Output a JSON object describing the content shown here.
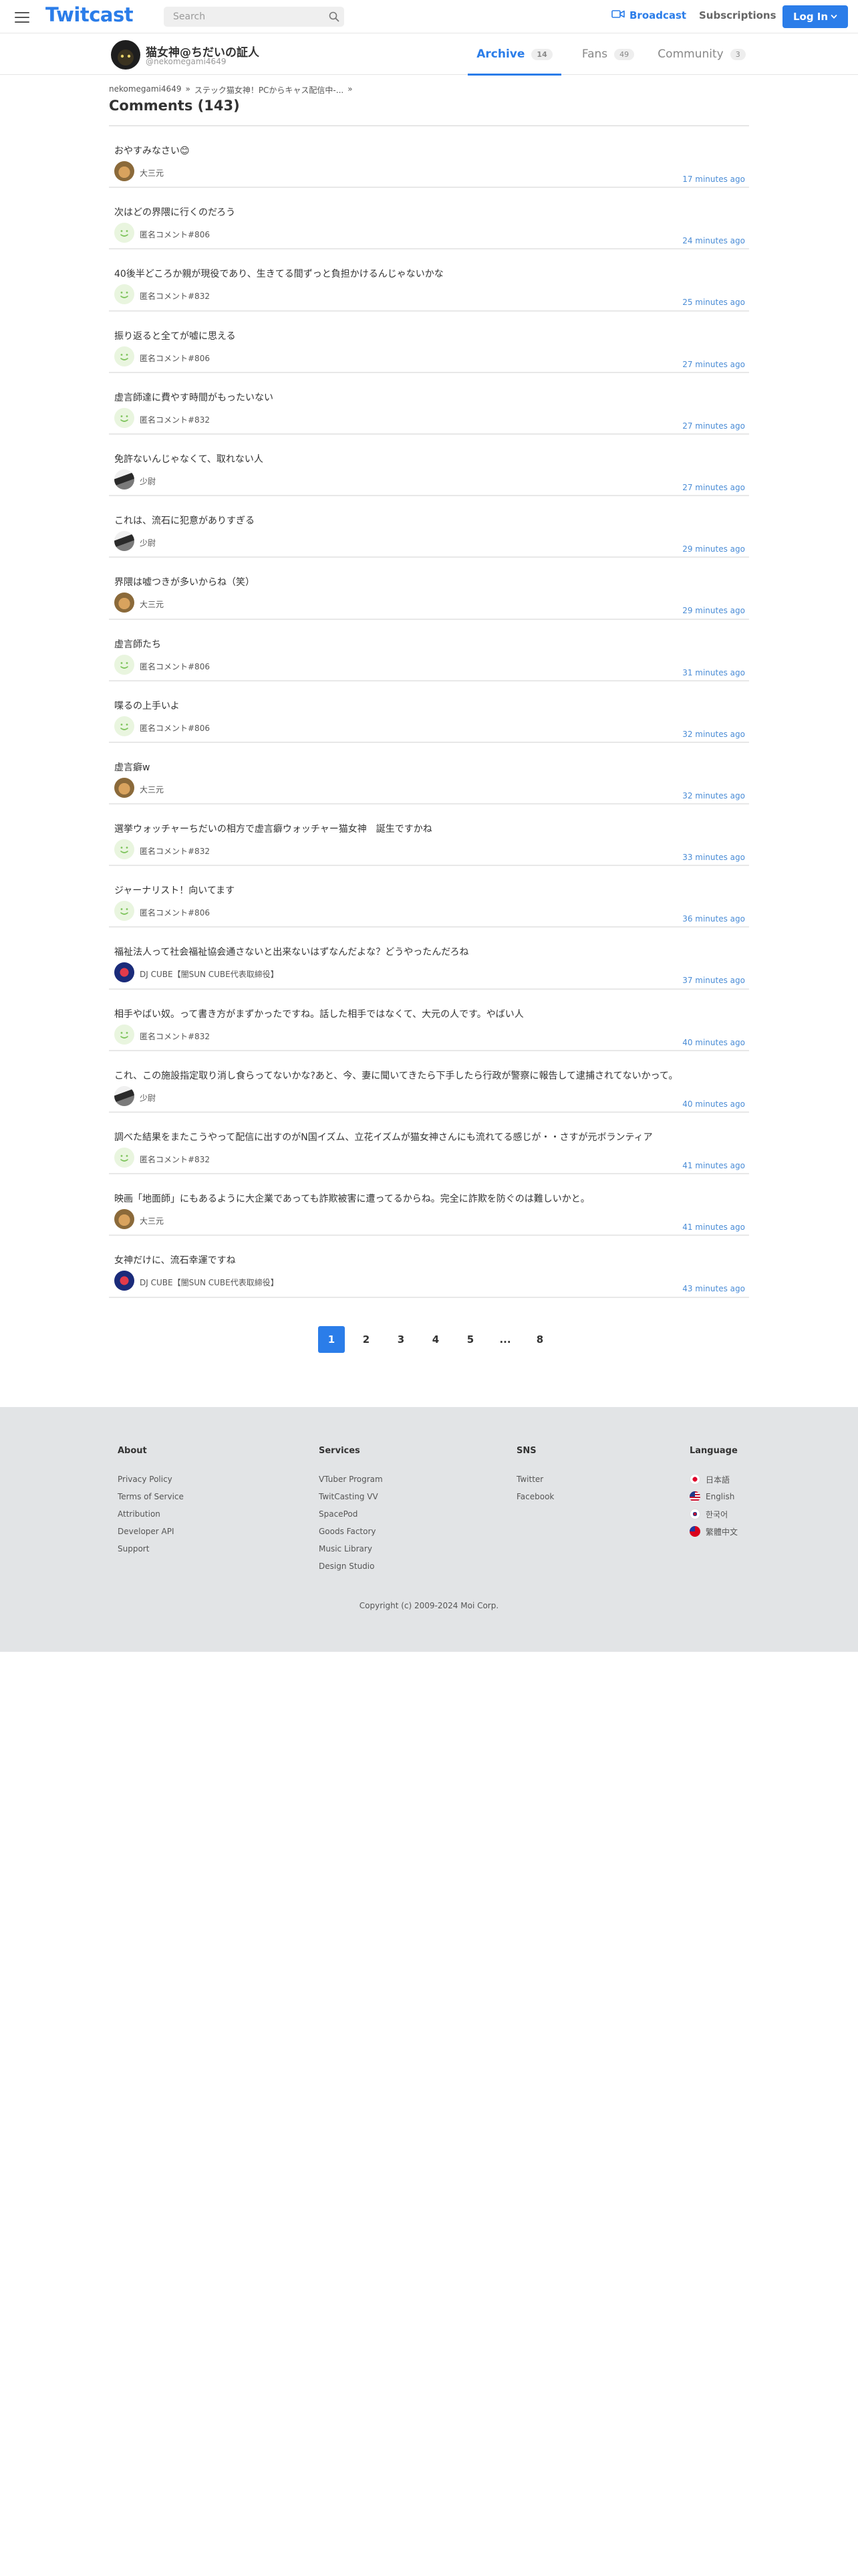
{
  "header": {
    "logo": "Twitcast",
    "search_placeholder": "Search",
    "broadcast": "Broadcast",
    "subscriptions": "Subscriptions",
    "login": "Log In"
  },
  "user": {
    "name": "猫女神@ちだいの証人",
    "id": "@nekomegami4649"
  },
  "tabs": [
    {
      "label": "Archive",
      "count": "14"
    },
    {
      "label": "Fans",
      "count": "49"
    },
    {
      "label": "Community",
      "count": "3"
    }
  ],
  "breadcrumb": {
    "user": "nekomegami4649",
    "sep1": "»",
    "movie": "ステック猫女神！PCからキャス配信中-...",
    "sep2": "»"
  },
  "comments_title": "Comments (143)",
  "comments": [
    {
      "text": "おやすみなさい😊",
      "user": "大三元",
      "time": "17 minutes ago",
      "avatar": "cat"
    },
    {
      "text": "次はどの界隈に行くのだろう",
      "user": "匿名コメント#806",
      "time": "24 minutes ago",
      "avatar": "smile"
    },
    {
      "text": "40後半どころか親が現役であり、生きてる間ずっと負担かけるんじゃないかな",
      "user": "匿名コメント#832",
      "time": "25 minutes ago",
      "avatar": "smile"
    },
    {
      "text": "振り返ると全てが嘘に思える",
      "user": "匿名コメント#806",
      "time": "27 minutes ago",
      "avatar": "smile"
    },
    {
      "text": "虚言師達に費やす時間がもったいない",
      "user": "匿名コメント#832",
      "time": "27 minutes ago",
      "avatar": "smile"
    },
    {
      "text": "免許ないんじゃなくて、取れない人",
      "user": "少尉",
      "time": "27 minutes ago",
      "avatar": "bw"
    },
    {
      "text": "これは、流石に犯意がありすぎる",
      "user": "少尉",
      "time": "29 minutes ago",
      "avatar": "bw"
    },
    {
      "text": "界隈は嘘つきが多いからね（笑）",
      "user": "大三元",
      "time": "29 minutes ago",
      "avatar": "cat"
    },
    {
      "text": "虚言師たち",
      "user": "匿名コメント#806",
      "time": "31 minutes ago",
      "avatar": "smile"
    },
    {
      "text": "喋るの上手いよ",
      "user": "匿名コメント#806",
      "time": "32 minutes ago",
      "avatar": "smile"
    },
    {
      "text": "虚言癖w",
      "user": "大三元",
      "time": "32 minutes ago",
      "avatar": "cat"
    },
    {
      "text": "選挙ウォッチャーちだいの相方で虚言癖ウォッチャー猫女神　誕生ですかね",
      "user": "匿名コメント#832",
      "time": "33 minutes ago",
      "avatar": "smile"
    },
    {
      "text": "ジャーナリスト！向いてます",
      "user": "匿名コメント#806",
      "time": "36 minutes ago",
      "avatar": "smile"
    },
    {
      "text": "福祉法人って社会福祉協会通さないと出来ないはずなんだよな？どうやったんだろね",
      "user": "DJ CUBE【闇SUN CUBE代表取締役】",
      "time": "37 minutes ago",
      "avatar": "dj"
    },
    {
      "text": "相手やばい奴。って書き方がまずかったですね。話した相手ではなくて、大元の人です。やばい人",
      "user": "匿名コメント#832",
      "time": "40 minutes ago",
      "avatar": "smile"
    },
    {
      "text": "これ、この施設指定取り消し食らってないかな?あと、今、妻に聞いてきたら下手したら行政が警察に報告して逮捕されてないかって。",
      "user": "少尉",
      "time": "40 minutes ago",
      "avatar": "bw"
    },
    {
      "text": "調べた結果をまたこうやって配信に出すのがN国イズム、立花イズムが猫女神さんにも流れてる感じが・・さすが元ボランティア",
      "user": "匿名コメント#832",
      "time": "41 minutes ago",
      "avatar": "smile"
    },
    {
      "text": "映画「地面師」にもあるように大企業であっても詐欺被害に遭ってるからね。完全に詐欺を防ぐのは難しいかと。",
      "user": "大三元",
      "time": "41 minutes ago",
      "avatar": "cat"
    },
    {
      "text": "女神だけに、流石幸運ですね",
      "user": "DJ CUBE【闇SUN CUBE代表取締役】",
      "time": "43 minutes ago",
      "avatar": "dj"
    }
  ],
  "pagination": [
    "1",
    "2",
    "3",
    "4",
    "5",
    "...",
    "8"
  ],
  "footer": {
    "about": {
      "title": "About",
      "items": [
        "Privacy Policy",
        "Terms of Service",
        "Attribution",
        "Developer API",
        "Support"
      ]
    },
    "services": {
      "title": "Services",
      "items": [
        "VTuber Program",
        "TwitCasting VV",
        "SpacePod",
        "Goods Factory",
        "Music Library",
        "Design Studio"
      ]
    },
    "sns": {
      "title": "SNS",
      "items": [
        "Twitter",
        "Facebook"
      ]
    },
    "language": {
      "title": "Language",
      "items": [
        {
          "label": "日本語",
          "flag": "jp"
        },
        {
          "label": "English",
          "flag": "us"
        },
        {
          "label": "한국어",
          "flag": "kr"
        },
        {
          "label": "繁體中文",
          "flag": "tw"
        }
      ]
    },
    "copyright": "Copyright (c) 2009-2024 Moi Corp."
  },
  "colors": {
    "accent": "#2b7de9",
    "time": "#4a8cd6",
    "footer_bg": "#e2e4e6"
  }
}
